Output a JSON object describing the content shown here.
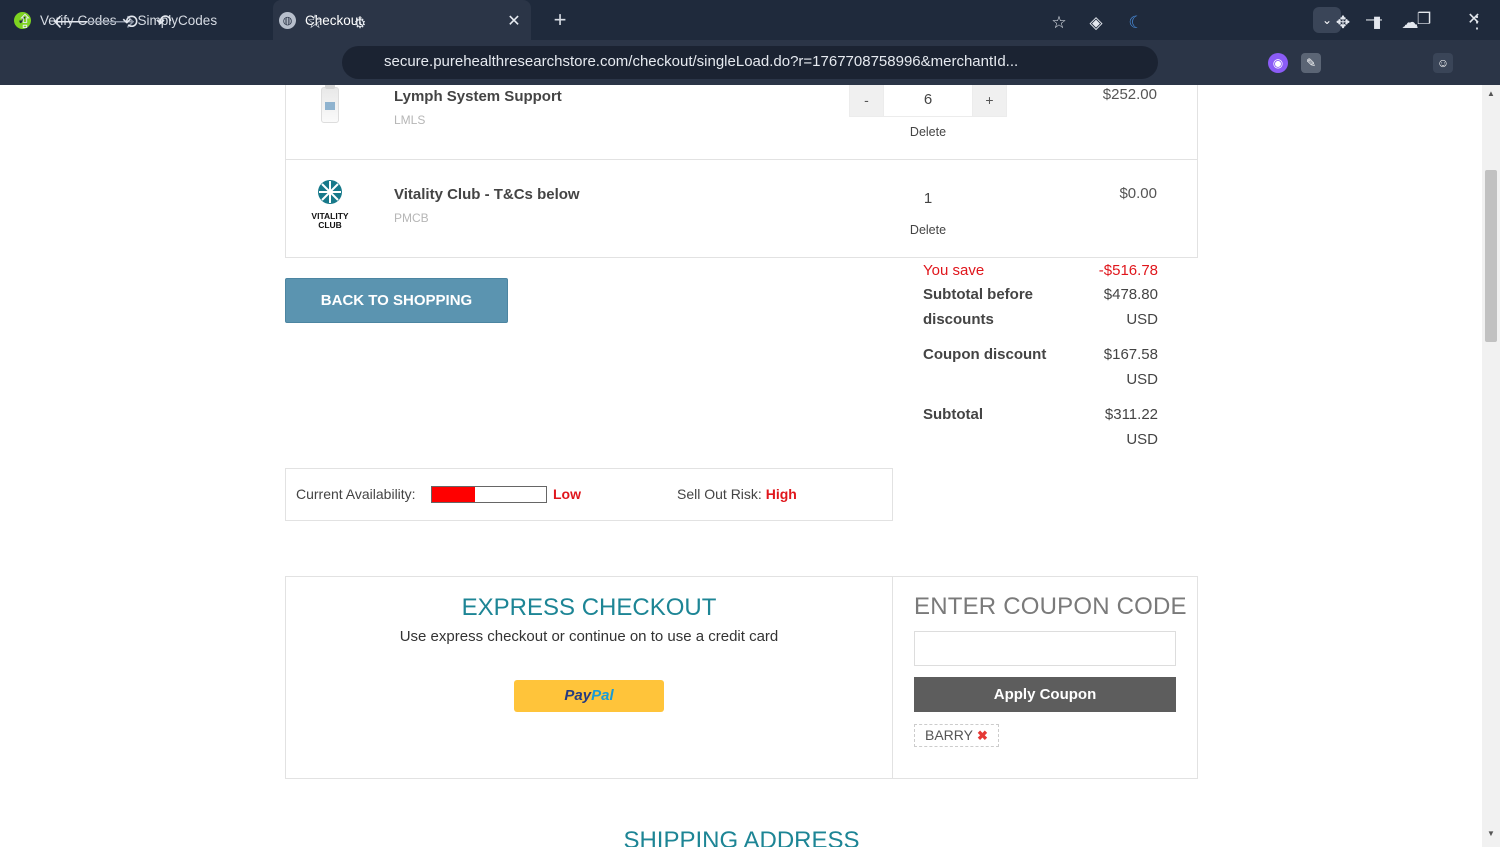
{
  "browser": {
    "tabs": [
      {
        "title": "Verify Codes — SimplyCodes",
        "icon": "simplycodes-icon"
      },
      {
        "title": "Checkout",
        "icon": "globe-icon"
      }
    ],
    "url": "secure.purehealthresearchstore.com/checkout/singleLoad.do?r=1767708758996&merchantId..."
  },
  "cart": {
    "items": [
      {
        "name": "Lymph System Support",
        "sku": "LMLS",
        "quantity": "6",
        "price": "$252.00",
        "delete_label": "Delete",
        "minus": "-",
        "plus": "+"
      },
      {
        "name": "Vitality Club - T&Cs below",
        "sku": "PMCB",
        "quantity": "1",
        "price": "$0.00",
        "delete_label": "Delete",
        "logo_text": "VITALITY CLUB"
      }
    ],
    "back_button": "BACK TO SHOPPING"
  },
  "summary": {
    "you_save_label": "You save",
    "you_save_value": "-$516.78",
    "subtotal_before_label_1": "Subtotal before",
    "subtotal_before_label_2": "discounts",
    "subtotal_before_value": "$478.80",
    "subtotal_before_currency": "USD",
    "coupon_discount_label": "Coupon discount",
    "coupon_discount_value": "$167.58",
    "coupon_discount_currency": "USD",
    "subtotal_label": "Subtotal",
    "subtotal_value": "$311.22",
    "subtotal_currency": "USD"
  },
  "availability": {
    "label": "Current Availability:",
    "level": 0.38,
    "level_text": "Low",
    "risk_label": "Sell Out Risk:",
    "risk_value": "High",
    "bar_color": "#ff0000"
  },
  "express": {
    "title": "EXPRESS CHECKOUT",
    "subtitle": "Use express checkout or continue on to use a credit card",
    "paypal_pay": "Pay",
    "paypal_pal": "Pal"
  },
  "coupon": {
    "title": "ENTER COUPON CODE",
    "input_value": "",
    "apply_label": "Apply Coupon",
    "applied_code": "BARRY"
  },
  "shipping": {
    "title": "SHIPPING ADDRESS"
  },
  "colors": {
    "teal": "#1d8595",
    "back_button": "#5b94b0",
    "red": "#e0161c",
    "paypal_yellow": "#ffc43a"
  }
}
